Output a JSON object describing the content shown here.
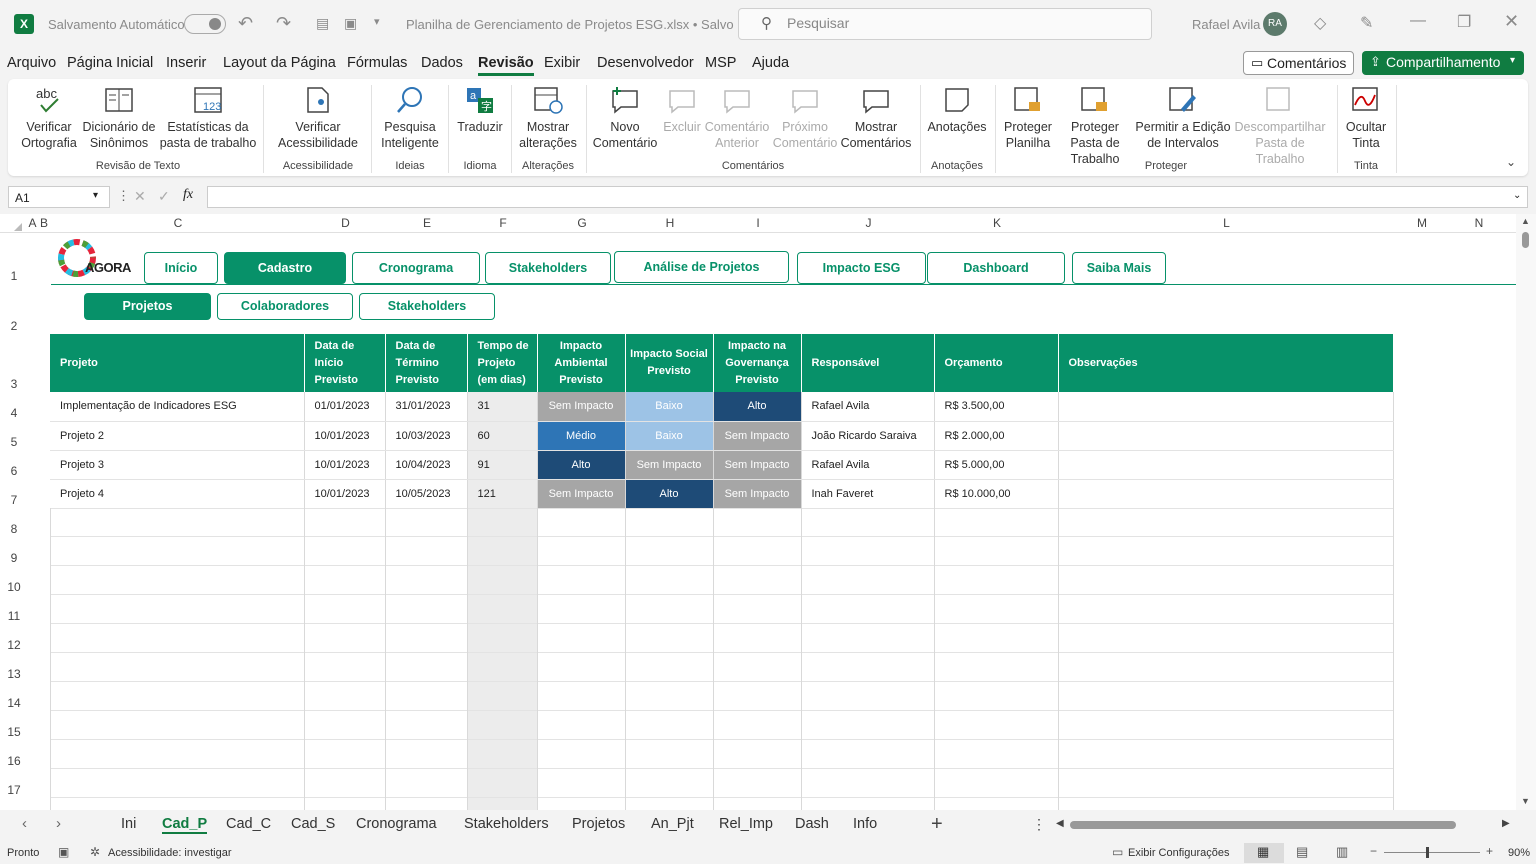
{
  "titlebar": {
    "autosave_label": "Salvamento Automático",
    "file_title": "Planilha de Gerenciamento de Projetos ESG.xlsx • Salvo",
    "search_placeholder": "Pesquisar",
    "user_name": "Rafael Avila",
    "user_initials": "RA"
  },
  "menu": [
    "Arquivo",
    "Página Inicial",
    "Inserir",
    "Layout da Página",
    "Fórmulas",
    "Dados",
    "Revisão",
    "Exibir",
    "Desenvolvedor",
    "MSP",
    "Ajuda"
  ],
  "menu_active": "Revisão",
  "comments_btn": "Comentários",
  "share_btn": "Compartilhamento",
  "ribbon": {
    "spell": "Verificar Ortografia",
    "thesaurus": "Dicionário de Sinônimos",
    "stats": "Estatísticas da pasta de trabalho",
    "access": "Verificar Acessibilidade",
    "smart": "Pesquisa Inteligente",
    "translate": "Traduzir",
    "changes": "Mostrar alterações",
    "newcomment": "Novo Comentário",
    "delete": "Excluir",
    "prev": "Comentário Anterior",
    "next": "Próximo Comentário",
    "show": "Mostrar Comentários",
    "notes": "Anotações",
    "protsheet": "Proteger Planilha",
    "protbook": "Proteger Pasta de Trabalho",
    "allow": "Permitir a Edição de Intervalos",
    "unshare": "Descompartilhar Pasta de Trabalho",
    "hideink": "Ocultar Tinta",
    "groups": {
      "revisao": "Revisão de Texto",
      "acess": "Acessibilidade",
      "ideias": "Ideias",
      "idioma": "Idioma",
      "alteracoes": "Alterações",
      "comentarios": "Comentários",
      "anotacoes": "Anotações",
      "proteger": "Proteger",
      "tinta": "Tinta"
    }
  },
  "formula": {
    "namebox": "A1",
    "fx": "fx",
    "value": ""
  },
  "columns": [
    "A",
    "B",
    "C",
    "D",
    "E",
    "F",
    "G",
    "H",
    "I",
    "J",
    "K",
    "L",
    "M",
    "N"
  ],
  "rows": [
    "1",
    "2",
    "3",
    "4",
    "5",
    "6",
    "7",
    "8",
    "9",
    "10",
    "11",
    "12",
    "13",
    "14",
    "15",
    "16",
    "17"
  ],
  "logo": {
    "text": "AGORA"
  },
  "nav_tabs": [
    "Início",
    "Cadastro",
    "Cronograma",
    "Stakeholders",
    "Análise de Projetos",
    "Impacto ESG",
    "Dashboard",
    "Saiba Mais"
  ],
  "nav_active": "Cadastro",
  "sub_tabs": [
    "Projetos",
    "Colaboradores",
    "Stakeholders"
  ],
  "sub_active": "Projetos",
  "table": {
    "headers": [
      "Projeto",
      "Data de Início Previsto",
      "Data de Término Previsto",
      "Tempo de Projeto (em dias)",
      "Impacto Ambiental Previsto",
      "Impacto Social Previsto",
      "Impacto na Governança Previsto",
      "Responsável",
      "Orçamento",
      "Observações"
    ],
    "rows": [
      [
        "Implementação de Indicadores ESG",
        "01/01/2023",
        "31/01/2023",
        "31",
        "Sem Impacto",
        "Baixo",
        "Alto",
        "Rafael Avila",
        "R$ 3.500,00",
        ""
      ],
      [
        "Projeto 2",
        "10/01/2023",
        "10/03/2023",
        "60",
        "Médio",
        "Baixo",
        "Sem Impacto",
        "João Ricardo Saraiva",
        "R$ 2.000,00",
        ""
      ],
      [
        "Projeto 3",
        "10/01/2023",
        "10/04/2023",
        "91",
        "Alto",
        "Sem Impacto",
        "Sem Impacto",
        "Rafael Avila",
        "R$ 5.000,00",
        ""
      ],
      [
        "Projeto 4",
        "10/01/2023",
        "10/05/2023",
        "121",
        "Sem Impacto",
        "Alto",
        "Sem Impacto",
        "Inah Faveret",
        "R$ 10.000,00",
        ""
      ]
    ]
  },
  "sheet_tabs": [
    "Ini",
    "Cad_P",
    "Cad_C",
    "Cad_S",
    "Cronograma",
    "Stakeholders",
    "Projetos",
    "An_Pjt",
    "Rel_Imp",
    "Dash",
    "Info"
  ],
  "sheet_active": "Cad_P",
  "status": {
    "ready": "Pronto",
    "accessibility": "Acessibilidade: investigar",
    "display": "Exibir Configurações",
    "zoom": "90%"
  }
}
